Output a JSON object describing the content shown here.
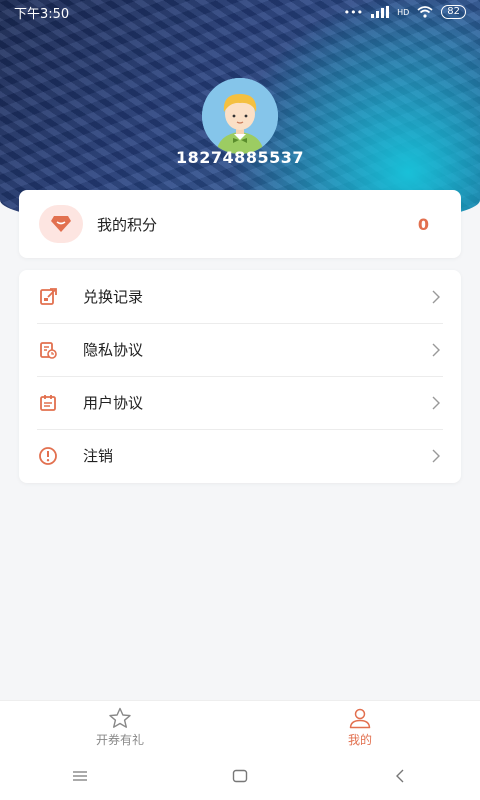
{
  "status_bar": {
    "time": "下午3:50",
    "signal_text": "HD",
    "battery": "82"
  },
  "profile": {
    "phone": "18274885537"
  },
  "points": {
    "label": "我的积分",
    "value": "0"
  },
  "menu": {
    "items": [
      {
        "label": "兑换记录",
        "icon": "exchange-record-icon"
      },
      {
        "label": "隐私协议",
        "icon": "privacy-icon"
      },
      {
        "label": "用户协议",
        "icon": "user-agreement-icon"
      },
      {
        "label": "注销",
        "icon": "logout-icon"
      }
    ]
  },
  "tabbar": {
    "tabs": [
      {
        "label": "开券有礼",
        "icon": "star-icon",
        "active": false
      },
      {
        "label": "我的",
        "icon": "user-icon",
        "active": true
      }
    ]
  },
  "colors": {
    "accent": "#e2704f",
    "inactive": "#888888"
  }
}
